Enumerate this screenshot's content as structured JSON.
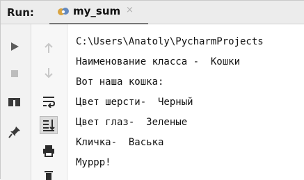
{
  "run_panel": {
    "label": "Run:",
    "tab_title": "my_sum",
    "tab_close": "×"
  },
  "console": {
    "lines": [
      "C:\\Users\\Anatoly\\PycharmProjects",
      "Наименование класса -  Кошки",
      "Вот наша кошка:",
      "Цвет шерсти-  Черный",
      "Цвет глаз-  Зеленые",
      "Кличка-  Васька",
      "Муррр!"
    ]
  },
  "icons": {
    "run": "play-icon",
    "up": "arrow-up-icon",
    "stop": "stop-icon",
    "down": "arrow-down-icon",
    "layout": "layout-icon",
    "soft_wrap": "soft-wrap-icon",
    "pin": "pin-icon",
    "scroll_end": "scroll-to-end-icon",
    "print": "print-icon",
    "trash": "trash-icon"
  },
  "colors": {
    "run_green": "#4e9a4e",
    "tab_icon_gold": "#d9a441",
    "tab_icon_blue": "#4a78b8"
  }
}
